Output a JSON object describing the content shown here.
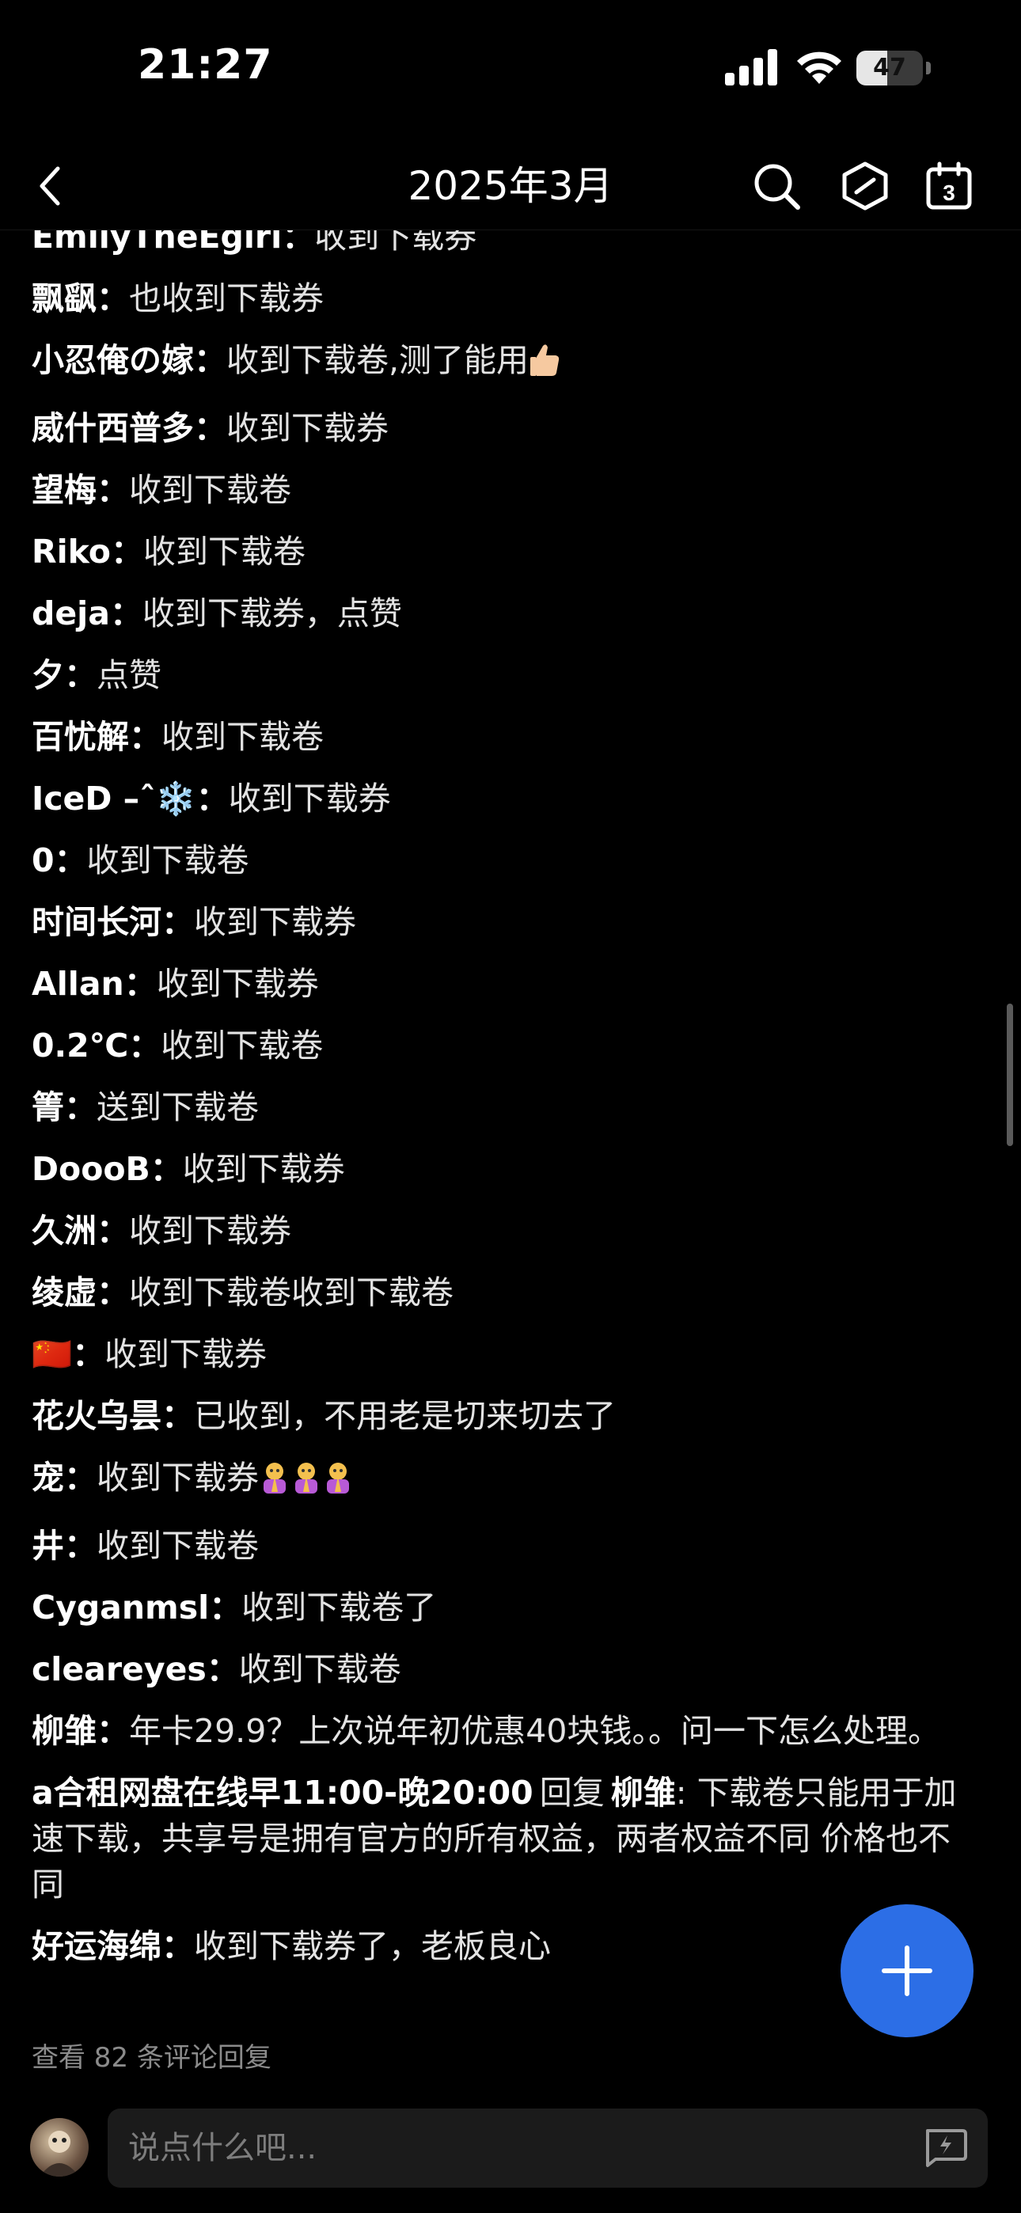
{
  "status_bar": {
    "time": "21:27",
    "battery_level": "47",
    "battery_fraction": 0.47,
    "icons": [
      "signal-icon",
      "wifi-icon",
      "battery-icon"
    ]
  },
  "nav": {
    "title": "2025年3月",
    "calendar_day": "3",
    "icons": [
      "back-icon",
      "search-icon",
      "hexagon-icon",
      "calendar-icon"
    ]
  },
  "comments": [
    {
      "author": "EmilyTheEgirl",
      "sep": "：",
      "text": "收到下载券"
    },
    {
      "author": "飘飖",
      "sep": "：",
      "text": "也收到下载券"
    },
    {
      "author": "小忍俺の嫁",
      "sep": "：",
      "text": "收到下载卷,测了能用",
      "emoji": "thumbs-up"
    },
    {
      "author": "威什西普多",
      "sep": "：",
      "text": "收到下载券"
    },
    {
      "author": "望梅",
      "sep": "：",
      "text": "收到下载卷"
    },
    {
      "author": "Riko",
      "sep": "：",
      "text": "收到下载卷"
    },
    {
      "author": "deja",
      "sep": "：",
      "text": "收到下载券，点赞"
    },
    {
      "author": "夕",
      "sep": "：",
      "text": "点赞"
    },
    {
      "author": "百忧解",
      "sep": "：",
      "text": "收到下载卷"
    },
    {
      "author": "IceD –ˆ❄️",
      "sep": "：",
      "text": "收到下载券"
    },
    {
      "author": "0",
      "sep": "：",
      "text": "收到下载卷"
    },
    {
      "author": "时间长河",
      "sep": "：",
      "text": "收到下载券"
    },
    {
      "author": "Allan",
      "sep": "：",
      "text": "收到下载券"
    },
    {
      "author": "0.2℃",
      "sep": "：",
      "text": "收到下载卷"
    },
    {
      "author": "箐",
      "sep": "：",
      "text": "送到下载卷"
    },
    {
      "author": "DoooB",
      "sep": "：",
      "text": "收到下载券"
    },
    {
      "author": "久洲",
      "sep": "：",
      "text": "收到下载券"
    },
    {
      "author": "绫虚",
      "sep": "：",
      "text": "收到下载卷收到下载卷"
    },
    {
      "author": "🇨🇳",
      "sep": "：",
      "text": "收到下载券"
    },
    {
      "author": "花火乌昙",
      "sep": "：",
      "text": "已收到，不用老是切来切去了"
    },
    {
      "author": "宠",
      "sep": "：",
      "text": "收到下载券",
      "emoji": "praying-x3"
    },
    {
      "author": "井",
      "sep": "：",
      "text": "收到下载卷"
    },
    {
      "author": "Cyganmsl",
      "sep": "：",
      "text": "收到下载卷了"
    },
    {
      "author": "cleareyes",
      "sep": "：",
      "text": "收到下载卷"
    },
    {
      "author": "柳雏",
      "sep": "：",
      "text": "年卡29.9？上次说年初优惠40块钱。。问一下怎么处理。"
    },
    {
      "author": "a合租网盘在线早11:00-晚20:00",
      "reply_word": "回复",
      "reply_to": "柳雏",
      "sep": ": ",
      "text": "下载卷只能用于加速下载，共享号是拥有官方的所有权益，两者权益不同 价格也不同"
    },
    {
      "author": "好运海绵",
      "sep": "：",
      "text": "收到下载券了，老板良心"
    }
  ],
  "view_replies": "查看 82 条评论回复",
  "fab": {
    "icon": "plus-icon"
  },
  "input": {
    "placeholder": "说点什么吧...",
    "icons": [
      "avatar",
      "quick-reply-icon"
    ]
  },
  "colors": {
    "background": "#000000",
    "fab": "#2c6ee6",
    "input_bg": "#1b1b1b",
    "muted_text": "#8b8b8b"
  }
}
